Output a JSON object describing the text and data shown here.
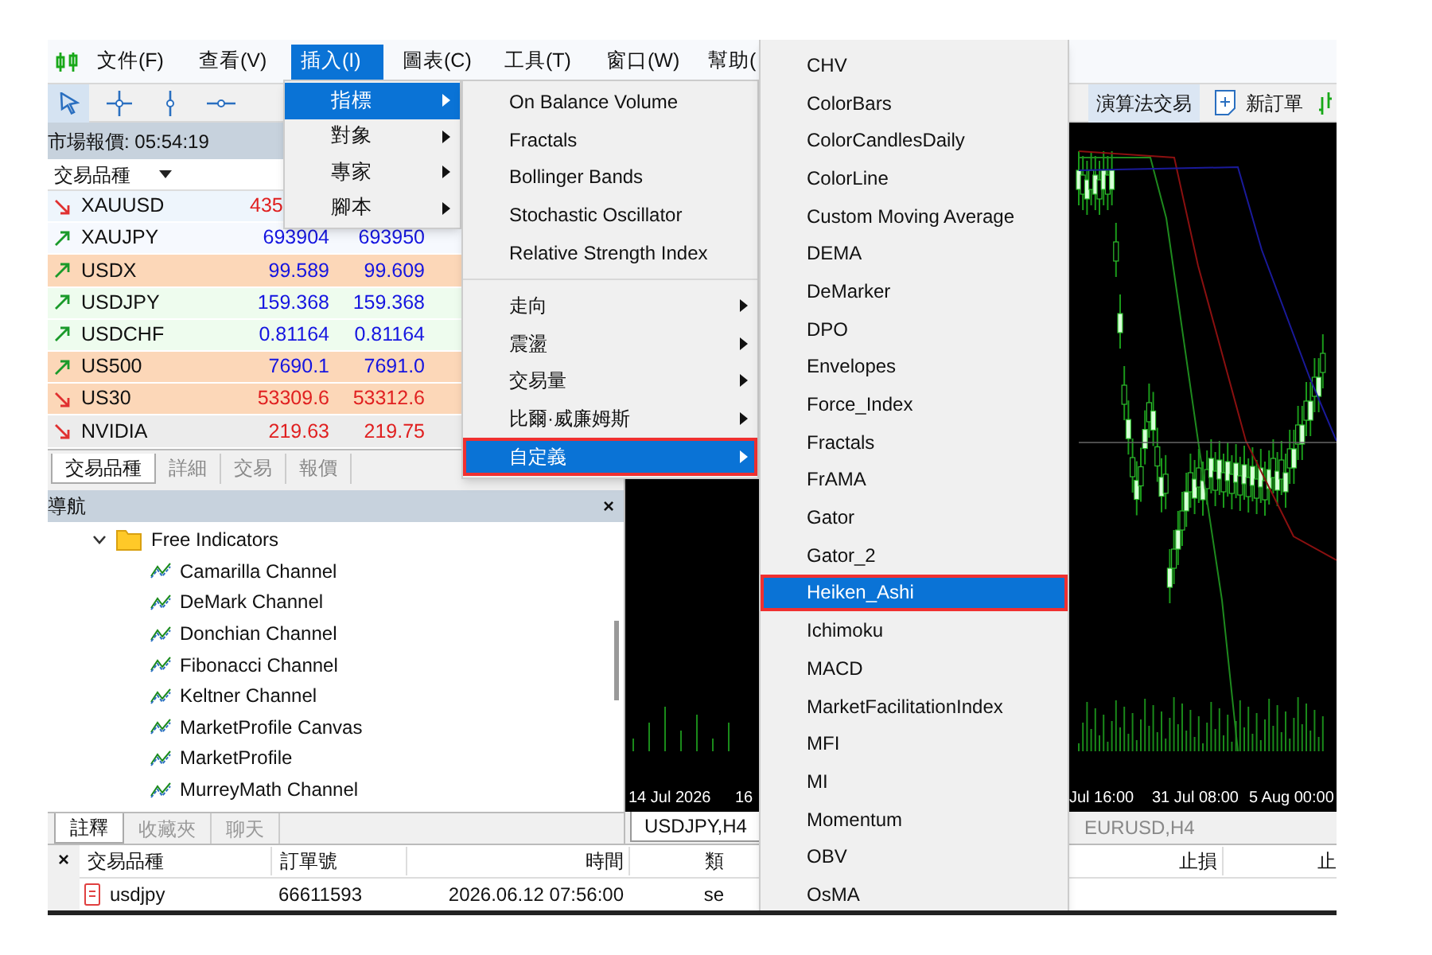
{
  "menu_bar": [
    {
      "label": "文件(F)",
      "selected": false
    },
    {
      "label": "查看(V)",
      "selected": false
    },
    {
      "label": "插入(I)",
      "selected": true
    },
    {
      "label": "圖表(C)",
      "selected": false
    },
    {
      "label": "工具(T)",
      "selected": false
    },
    {
      "label": "窗口(W)",
      "selected": false
    },
    {
      "label": "幫助(",
      "selected": false
    }
  ],
  "toolbar": {
    "tools": [
      {
        "kind": "cursor",
        "selected": true
      },
      {
        "kind": "crosshair",
        "selected": false
      },
      {
        "kind": "vertical-line",
        "selected": false
      },
      {
        "kind": "horizontal-line",
        "selected": false
      }
    ],
    "buttons": [
      {
        "label": "演算法交易",
        "kind": "algo",
        "selected": true
      },
      {
        "label": "新訂單",
        "kind": "new-order",
        "selected": false
      }
    ]
  },
  "market_watch": {
    "title": "市場報價: 05:54:19",
    "column_1": "交易品種",
    "rows": [
      {
        "symbol": "XAUUSD",
        "rising": false,
        "clipped": true,
        "bid": "435",
        "color": "#eef5fc"
      },
      {
        "symbol": "XAUJPY",
        "rising": true,
        "clipped": false,
        "bid": "693904",
        "ask": "693950",
        "color": "#f6f9fe"
      },
      {
        "symbol": "USDX",
        "rising": true,
        "clipped": false,
        "bid": "99.589",
        "ask": "99.609",
        "color": "#fcd7b8"
      },
      {
        "symbol": "USDJPY",
        "rising": true,
        "clipped": false,
        "bid": "159.368",
        "ask": "159.368",
        "color": "#eefcee"
      },
      {
        "symbol": "USDCHF",
        "rising": true,
        "clipped": false,
        "bid": "0.81164",
        "ask": "0.81164",
        "color": "#eefcee"
      },
      {
        "symbol": "US500",
        "rising": true,
        "clipped": false,
        "bid": "7690.1",
        "ask": "7691.0",
        "color": "#fcd7b8"
      },
      {
        "symbol": "US30",
        "rising": false,
        "clipped": false,
        "bid": "53309.6",
        "ask": "53312.6",
        "color": "#fcd7b8"
      },
      {
        "symbol": "NVIDIA",
        "rising": false,
        "clipped": false,
        "bid": "219.63",
        "ask": "219.75",
        "color": "#ececec"
      }
    ],
    "tabs": [
      {
        "label": "交易品種",
        "selected": true
      },
      {
        "label": "詳細",
        "selected": false
      },
      {
        "label": "交易",
        "selected": false
      },
      {
        "label": "報價",
        "selected": false
      }
    ]
  },
  "navigator": {
    "title": "導航",
    "close": "×",
    "tree": [
      {
        "label": "Free Indicators",
        "expanded": true,
        "children": [
          {
            "label": "Camarilla Channel"
          },
          {
            "label": "DeMark Channel"
          },
          {
            "label": "Donchian Channel"
          },
          {
            "label": "Fibonacci Channel"
          },
          {
            "label": "Keltner Channel"
          },
          {
            "label": "MarketProfile Canvas"
          },
          {
            "label": "MarketProfile"
          },
          {
            "label": "MurreyMath Channel"
          }
        ]
      }
    ],
    "tabs": [
      {
        "label": "註釋",
        "selected": true
      },
      {
        "label": "收藏夾",
        "selected": false
      },
      {
        "label": "聊天",
        "selected": false
      }
    ]
  },
  "chart": {
    "time_labels": [
      "14 Jul 2026",
      "16",
      "Jul 16:00",
      "31 Jul 08:00",
      "5 Aug 00:00"
    ],
    "tabs": [
      {
        "label": "USDJPY,H4",
        "selected": true
      },
      {
        "label": "EURUSD,H4",
        "selected": false
      }
    ]
  },
  "terminal": {
    "close": "×",
    "columns": [
      "交易品種",
      "訂單號",
      "時間",
      "類",
      "止損",
      "止"
    ],
    "rows": [
      {
        "symbol": "usdjpy",
        "order": "66611593",
        "time": "2026.06.12 07:56:00",
        "type": "se"
      }
    ]
  },
  "insert_menu": [
    {
      "label": "指標",
      "selected": true
    },
    {
      "label": "對象",
      "selected": false
    },
    {
      "label": "專家",
      "selected": false
    },
    {
      "label": "腳本",
      "selected": false
    }
  ],
  "indicators_menu": [
    {
      "label": "On Balance Volume",
      "kind": "item",
      "selected": false,
      "outlined": false
    },
    {
      "label": "Fractals",
      "kind": "item",
      "selected": false,
      "outlined": false
    },
    {
      "label": "Bollinger Bands",
      "kind": "item",
      "selected": false,
      "outlined": false
    },
    {
      "label": "Stochastic Oscillator",
      "kind": "item",
      "selected": false,
      "outlined": false
    },
    {
      "label": "Relative Strength Index",
      "kind": "item",
      "selected": false,
      "outlined": false
    },
    {
      "label": "走向",
      "kind": "submenu",
      "selected": false,
      "outlined": false
    },
    {
      "label": "震盪",
      "kind": "submenu",
      "selected": false,
      "outlined": false
    },
    {
      "label": "交易量",
      "kind": "submenu",
      "selected": false,
      "outlined": false
    },
    {
      "label": "比爾·威廉姆斯",
      "kind": "submenu",
      "selected": false,
      "outlined": false
    },
    {
      "label": "自定義",
      "kind": "submenu",
      "selected": true,
      "outlined": true
    }
  ],
  "custom_menu": [
    {
      "label": "CHV",
      "selected": false,
      "outlined": false
    },
    {
      "label": "ColorBars",
      "selected": false,
      "outlined": false
    },
    {
      "label": "ColorCandlesDaily",
      "selected": false,
      "outlined": false
    },
    {
      "label": "ColorLine",
      "selected": false,
      "outlined": false
    },
    {
      "label": "Custom Moving Average",
      "selected": false,
      "outlined": false
    },
    {
      "label": "DEMA",
      "selected": false,
      "outlined": false
    },
    {
      "label": "DeMarker",
      "selected": false,
      "outlined": false
    },
    {
      "label": "DPO",
      "selected": false,
      "outlined": false
    },
    {
      "label": "Envelopes",
      "selected": false,
      "outlined": false
    },
    {
      "label": "Force_Index",
      "selected": false,
      "outlined": false
    },
    {
      "label": "Fractals",
      "selected": false,
      "outlined": false
    },
    {
      "label": "FrAMA",
      "selected": false,
      "outlined": false
    },
    {
      "label": "Gator",
      "selected": false,
      "outlined": false
    },
    {
      "label": "Gator_2",
      "selected": false,
      "outlined": false
    },
    {
      "label": "Heiken_Ashi",
      "selected": true,
      "outlined": true
    },
    {
      "label": "Ichimoku",
      "selected": false,
      "outlined": false
    },
    {
      "label": "MACD",
      "selected": false,
      "outlined": false
    },
    {
      "label": "MarketFacilitationIndex",
      "selected": false,
      "outlined": false
    },
    {
      "label": "MFI",
      "selected": false,
      "outlined": false
    },
    {
      "label": "MI",
      "selected": false,
      "outlined": false
    },
    {
      "label": "Momentum",
      "selected": false,
      "outlined": false
    },
    {
      "label": "OBV",
      "selected": false,
      "outlined": false
    },
    {
      "label": "OsMA",
      "selected": false,
      "outlined": false
    }
  ]
}
